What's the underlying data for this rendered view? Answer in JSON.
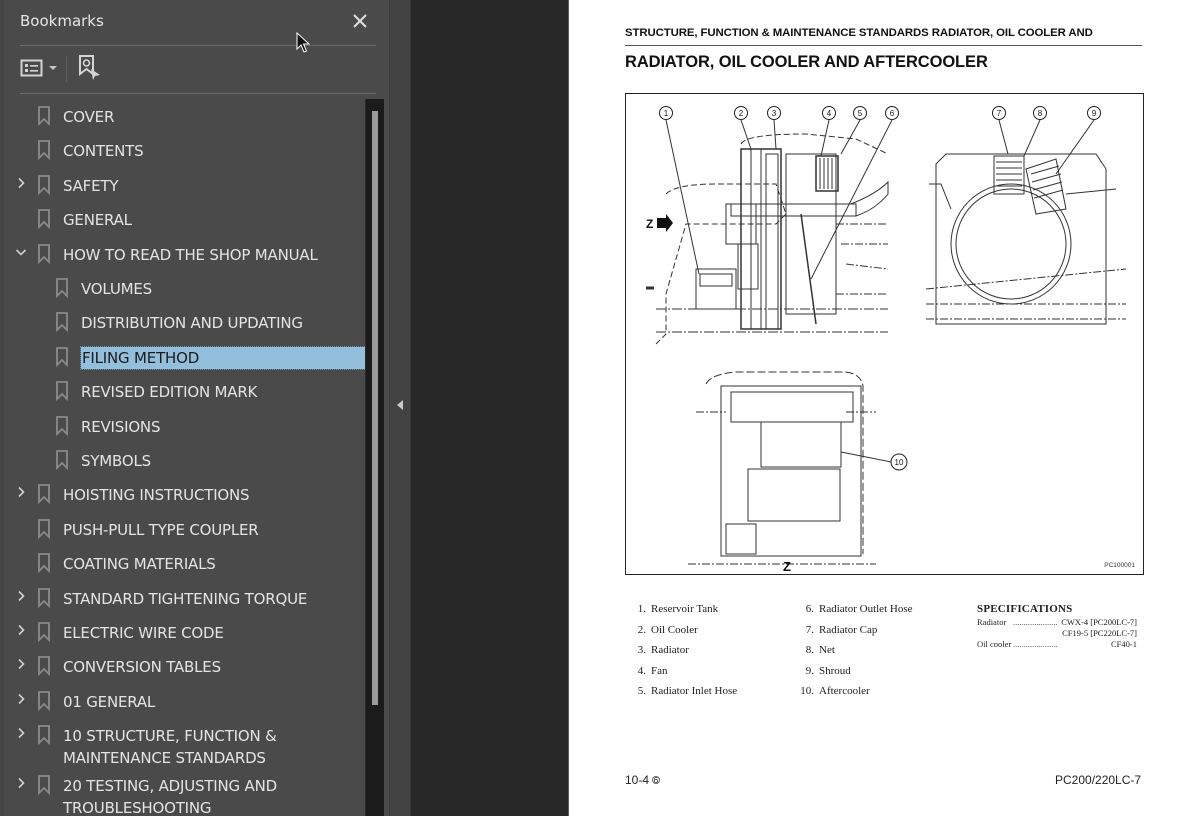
{
  "bookmarks_panel": {
    "title": "Bookmarks",
    "close_icon": "close-icon",
    "toolbar": {
      "options_icon": "list-options-icon",
      "options_dropdown_icon": "caret-down-icon",
      "find_bookmark_icon": "find-current-bookmark-icon"
    },
    "items": [
      {
        "label": "COVER",
        "level": 0,
        "expander": "none"
      },
      {
        "label": "CONTENTS",
        "level": 0,
        "expander": "none"
      },
      {
        "label": "SAFETY",
        "level": 0,
        "expander": "collapsed"
      },
      {
        "label": "GENERAL",
        "level": 0,
        "expander": "none"
      },
      {
        "label": "HOW TO READ THE SHOP MANUAL",
        "level": 0,
        "expander": "expanded"
      },
      {
        "label": "VOLUMES",
        "level": 1,
        "expander": "none"
      },
      {
        "label": "DISTRIBUTION AND UPDATING",
        "level": 1,
        "expander": "none"
      },
      {
        "label": "FILING METHOD",
        "level": 1,
        "expander": "none",
        "selected": true
      },
      {
        "label": "REVISED EDITION MARK",
        "level": 1,
        "expander": "none"
      },
      {
        "label": "REVISIONS",
        "level": 1,
        "expander": "none"
      },
      {
        "label": "SYMBOLS",
        "level": 1,
        "expander": "none"
      },
      {
        "label": "HOISTING INSTRUCTIONS",
        "level": 0,
        "expander": "collapsed"
      },
      {
        "label": "PUSH-PULL TYPE COUPLER",
        "level": 0,
        "expander": "none"
      },
      {
        "label": "COATING MATERIALS",
        "level": 0,
        "expander": "none"
      },
      {
        "label": "STANDARD TIGHTENING TORQUE",
        "level": 0,
        "expander": "collapsed"
      },
      {
        "label": "ELECTRIC WIRE CODE",
        "level": 0,
        "expander": "collapsed"
      },
      {
        "label": "CONVERSION TABLES",
        "level": 0,
        "expander": "collapsed"
      },
      {
        "label": "01 GENERAL",
        "level": 0,
        "expander": "collapsed"
      },
      {
        "label": "10 STRUCTURE, FUNCTION &",
        "label2": "MAINTENANCE STANDARDS",
        "level": 0,
        "expander": "collapsed"
      },
      {
        "label": "20 TESTING, ADJUSTING AND",
        "label2": "TROUBLESHOOTING",
        "level": 0,
        "expander": "collapsed"
      }
    ],
    "selection_color": "#94bfdc"
  },
  "collapse_panel_icon": "triangle-left-icon",
  "document_page": {
    "running_header": "STRUCTURE, FUNCTION & MAINTENANCE STANDARDS RADIATOR, OIL COOLER AND",
    "title": "RADIATOR, OIL COOLER AND AFTERCOOLER",
    "figure": {
      "callouts": [
        "1",
        "2",
        "3",
        "4",
        "5",
        "6",
        "7",
        "8",
        "9",
        "10"
      ],
      "view_arrow_label": "Z",
      "view_label": "Z",
      "figure_code": "PC100001"
    },
    "parts_left": [
      {
        "num": "1.",
        "name": "Reservoir Tank"
      },
      {
        "num": "2.",
        "name": "Oil Cooler"
      },
      {
        "num": "3.",
        "name": "Radiator"
      },
      {
        "num": "4.",
        "name": "Fan"
      },
      {
        "num": "5.",
        "name": "Radiator Inlet Hose"
      }
    ],
    "parts_right": [
      {
        "num": "6.",
        "name": "Radiator Outlet Hose"
      },
      {
        "num": "7.",
        "name": "Radiator Cap"
      },
      {
        "num": "8.",
        "name": "Net"
      },
      {
        "num": "9.",
        "name": "Shroud"
      },
      {
        "num": "10.",
        "name": "Aftercooler"
      }
    ],
    "specifications": {
      "title": "SPECIFICATIONS",
      "lines": [
        {
          "key": "Radiator",
          "value": "CWX-4 [PC200LC-7]"
        },
        {
          "key": "",
          "value": "CF19-5 [PC220LC-7]"
        },
        {
          "key": "Oil cooler",
          "value": "CF40-1"
        }
      ]
    },
    "footer_left": "10-4",
    "footer_rev_mark": "6",
    "footer_right": "PC200/220LC-7"
  }
}
